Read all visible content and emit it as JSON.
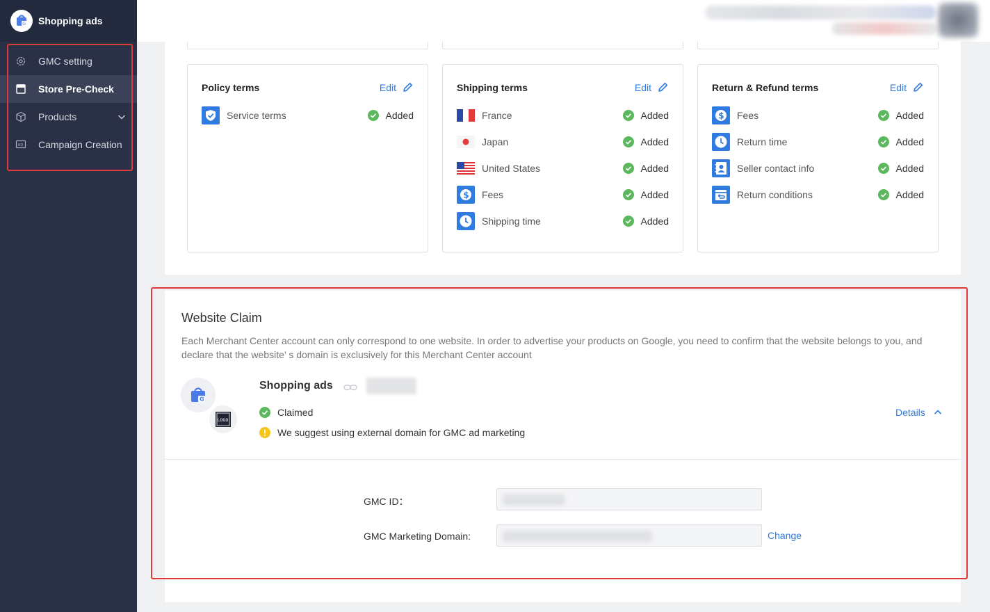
{
  "app": {
    "title": "Shopping ads"
  },
  "sidebar": {
    "items": [
      {
        "label": "GMC setting",
        "icon": "gear-icon"
      },
      {
        "label": "Store Pre-Check",
        "icon": "store-icon",
        "active": true
      },
      {
        "label": "Products",
        "icon": "box-icon",
        "expandable": true
      },
      {
        "label": "Campaign Creation",
        "icon": "ad-icon"
      }
    ]
  },
  "terms": {
    "edit_label": "Edit",
    "policy": {
      "title": "Policy terms",
      "rows": [
        {
          "label": "Service terms",
          "status": "Added",
          "icon": "shield-icon"
        }
      ]
    },
    "shipping": {
      "title": "Shipping terms",
      "rows": [
        {
          "label": "France",
          "status": "Added",
          "icon": "flag-france-icon"
        },
        {
          "label": "Japan",
          "status": "Added",
          "icon": "flag-japan-icon"
        },
        {
          "label": "United States",
          "status": "Added",
          "icon": "flag-us-icon"
        },
        {
          "label": "Fees",
          "status": "Added",
          "icon": "dollar-icon"
        },
        {
          "label": "Shipping time",
          "status": "Added",
          "icon": "clock-icon"
        }
      ]
    },
    "refund": {
      "title": "Return & Refund terms",
      "rows": [
        {
          "label": "Fees",
          "status": "Added",
          "icon": "dollar-icon"
        },
        {
          "label": "Return time",
          "status": "Added",
          "icon": "clock-icon"
        },
        {
          "label": "Seller contact info",
          "status": "Added",
          "icon": "contact-icon"
        },
        {
          "label": "Return conditions",
          "status": "Added",
          "icon": "return-icon"
        }
      ]
    }
  },
  "claim": {
    "title": "Website Claim",
    "description": "Each Merchant Center account can only correspond to one website. In order to advertise your products on Google, you need to confirm that the website belongs to you, and declare that the website’ s domain is exclusively for this Merchant Center account",
    "shop_name": "Shopping ads",
    "logo_text": "LOGO",
    "status": "Claimed",
    "warning": "We suggest using external domain for GMC ad marketing",
    "details_label": "Details",
    "gmc_id_label": "GMC ID：",
    "domain_label": "GMC Marketing Domain:",
    "change_label": "Change"
  },
  "colors": {
    "accent": "#2f7be0",
    "success": "#5cb85c",
    "warning": "#f5c518",
    "sidebar": "#2a3146",
    "highlight": "#e0393a"
  }
}
